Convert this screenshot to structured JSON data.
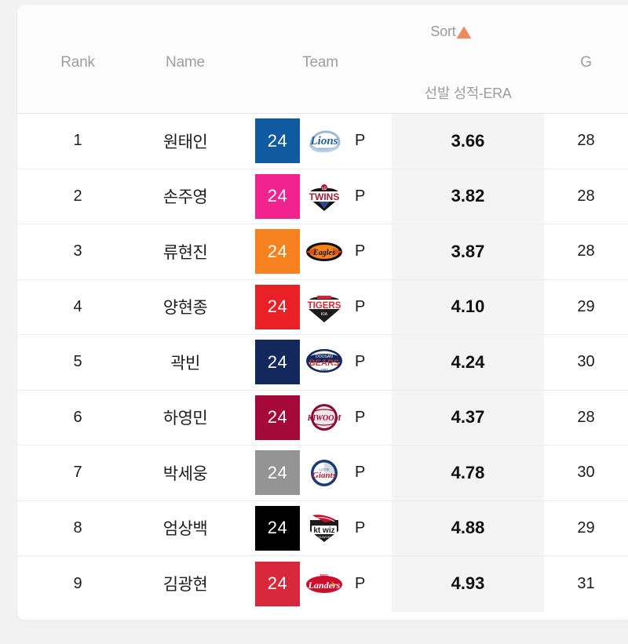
{
  "header": {
    "sort_label": "Sort",
    "sort_icon": "triangle-up-icon",
    "sort_direction": "asc",
    "sort_accent_color": "#f08a5d",
    "columns": {
      "rank": "Rank",
      "name": "Name",
      "team": "Team",
      "era": "선발 성적-ERA",
      "g": "G"
    }
  },
  "table": {
    "rows": [
      {
        "rank": "1",
        "name": "원태인",
        "jersey": "24",
        "team_code": "lions",
        "team_name": "삼성 라이온즈",
        "team_color": "#0F5AA0",
        "position": "P",
        "era": "3.66",
        "g": "28"
      },
      {
        "rank": "2",
        "name": "손주영",
        "jersey": "24",
        "team_code": "twins",
        "team_name": "LG 트윈스",
        "team_color": "#F2238F",
        "position": "P",
        "era": "3.82",
        "g": "28"
      },
      {
        "rank": "3",
        "name": "류현진",
        "jersey": "24",
        "team_code": "eagles",
        "team_name": "한화 이글스",
        "team_color": "#F5821F",
        "position": "P",
        "era": "3.87",
        "g": "28"
      },
      {
        "rank": "4",
        "name": "양현종",
        "jersey": "24",
        "team_code": "tigers",
        "team_name": "KIA 타이거즈",
        "team_color": "#EA2027",
        "position": "P",
        "era": "4.10",
        "g": "29"
      },
      {
        "rank": "5",
        "name": "곽빈",
        "jersey": "24",
        "team_code": "bears",
        "team_name": "두산 베어스",
        "team_color": "#13295E",
        "position": "P",
        "era": "4.24",
        "g": "30"
      },
      {
        "rank": "6",
        "name": "하영민",
        "jersey": "24",
        "team_code": "heroes",
        "team_name": "키움 히어로즈",
        "team_color": "#A4093A",
        "position": "P",
        "era": "4.37",
        "g": "28"
      },
      {
        "rank": "7",
        "name": "박세웅",
        "jersey": "24",
        "team_code": "giants",
        "team_name": "롯데 자이언츠",
        "team_color": "#949494",
        "position": "P",
        "era": "4.78",
        "g": "30"
      },
      {
        "rank": "8",
        "name": "엄상백",
        "jersey": "24",
        "team_code": "wiz",
        "team_name": "KT 위즈",
        "team_color": "#000000",
        "position": "P",
        "era": "4.88",
        "g": "29"
      },
      {
        "rank": "9",
        "name": "김광현",
        "jersey": "24",
        "team_code": "landers",
        "team_name": "SSG 랜더스",
        "team_color": "#D8283C",
        "position": "P",
        "era": "4.93",
        "g": "31"
      }
    ]
  }
}
